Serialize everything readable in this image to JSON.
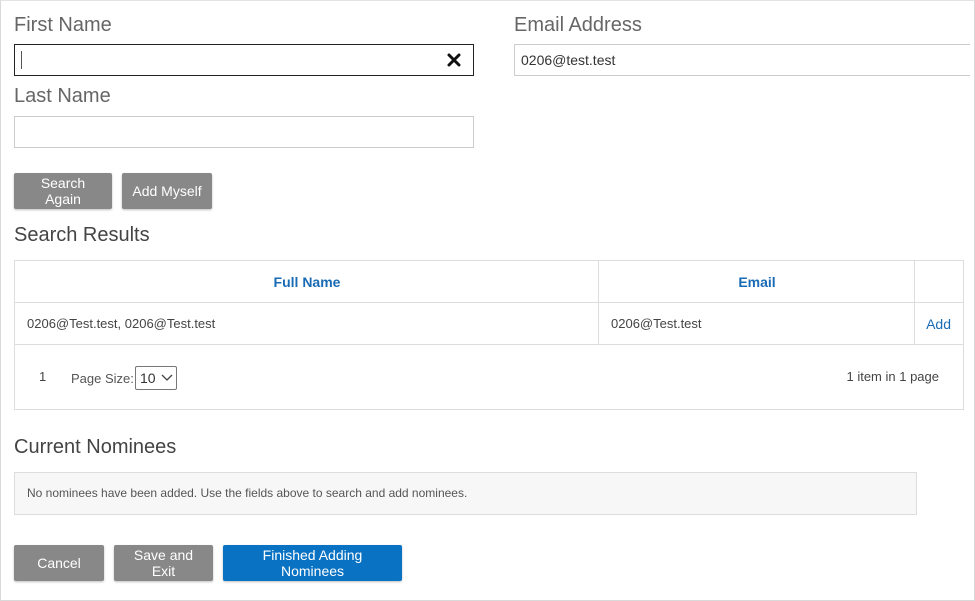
{
  "form": {
    "first_name_label": "First Name",
    "first_name_value": "",
    "last_name_label": "Last Name",
    "last_name_value": "",
    "email_label": "Email Address",
    "email_value": "0206@test.test"
  },
  "actions": {
    "search_again": "Search Again",
    "add_myself": "Add Myself"
  },
  "search_results": {
    "title": "Search Results",
    "columns": [
      "Full Name",
      "Email",
      ""
    ],
    "rows": [
      {
        "full_name": "0206@Test.test, 0206@Test.test",
        "email": "0206@Test.test",
        "action": "Add"
      }
    ],
    "pager": {
      "current_page": "1",
      "page_size_label": "Page Size:",
      "page_size_value": "10",
      "info": "1 item in 1 page"
    }
  },
  "nominees": {
    "title": "Current Nominees",
    "empty_message": "No nominees have been added. Use the fields above to search and add nominees."
  },
  "footer": {
    "cancel": "Cancel",
    "save_exit": "Save and Exit",
    "finished": "Finished Adding Nominees"
  },
  "colors": {
    "primary": "#0a72c3",
    "secondary_button": "#888888",
    "link": "#1a6bb5"
  },
  "icons": {
    "clear": "close-icon",
    "dropdown": "chevron-down-icon"
  }
}
